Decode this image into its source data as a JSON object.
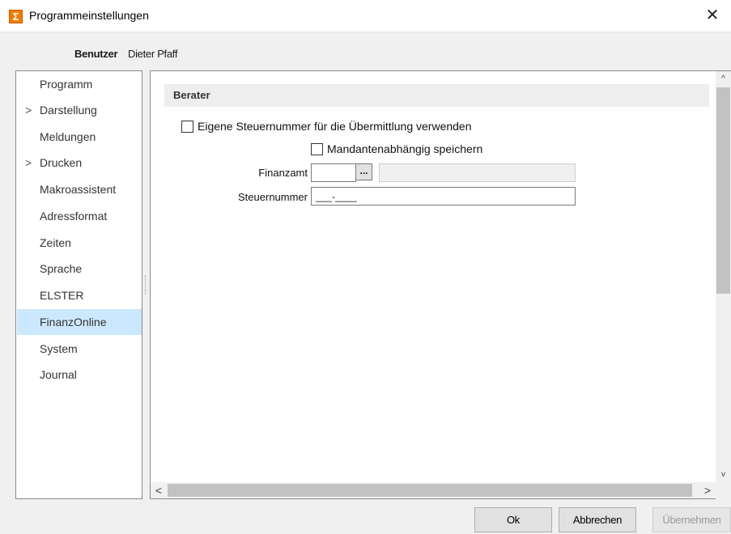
{
  "window": {
    "title": "Programmeinstellungen",
    "icon": "sigma-icon",
    "icon_glyph": "Σ",
    "close_glyph": "✕",
    "accent_color": "#f27c00"
  },
  "user": {
    "label": "Benutzer",
    "name": "Dieter Pfaff"
  },
  "sidebar": {
    "items": [
      {
        "label": "Programm",
        "expandable": false,
        "selected": false
      },
      {
        "label": "Darstellung",
        "expandable": true,
        "selected": false
      },
      {
        "label": "Meldungen",
        "expandable": false,
        "selected": false
      },
      {
        "label": "Drucken",
        "expandable": true,
        "selected": false
      },
      {
        "label": "Makroassistent",
        "expandable": false,
        "selected": false
      },
      {
        "label": "Adressformat",
        "expandable": false,
        "selected": false
      },
      {
        "label": "Zeiten",
        "expandable": false,
        "selected": false
      },
      {
        "label": "Sprache",
        "expandable": false,
        "selected": false
      },
      {
        "label": "ELSTER",
        "expandable": false,
        "selected": false
      },
      {
        "label": "FinanzOnline",
        "expandable": false,
        "selected": true
      },
      {
        "label": "System",
        "expandable": false,
        "selected": false
      },
      {
        "label": "Journal",
        "expandable": false,
        "selected": false
      }
    ],
    "chevron_glyph": ">",
    "selected_color": "#cce8ff"
  },
  "main": {
    "section_title": "Berater",
    "own_tax_number": {
      "label": "Eigene Steuernummer für die Übermittlung verwenden",
      "checked": false
    },
    "client_dependent": {
      "label": "Mandantenabhängig speichern",
      "checked": false
    },
    "finanzamt": {
      "label": "Finanzamt",
      "value": "",
      "lookup_label": "...",
      "name_value": ""
    },
    "steuernummer": {
      "label": "Steuernummer",
      "value": "___-____"
    }
  },
  "scrollbars": {
    "up_glyph": "^",
    "down_glyph": "v",
    "left_glyph": "<",
    "right_glyph": ">"
  },
  "footer": {
    "ok_label": "Ok",
    "cancel_label": "Abbrechen",
    "apply_label": "Übernehmen",
    "apply_enabled": false
  }
}
